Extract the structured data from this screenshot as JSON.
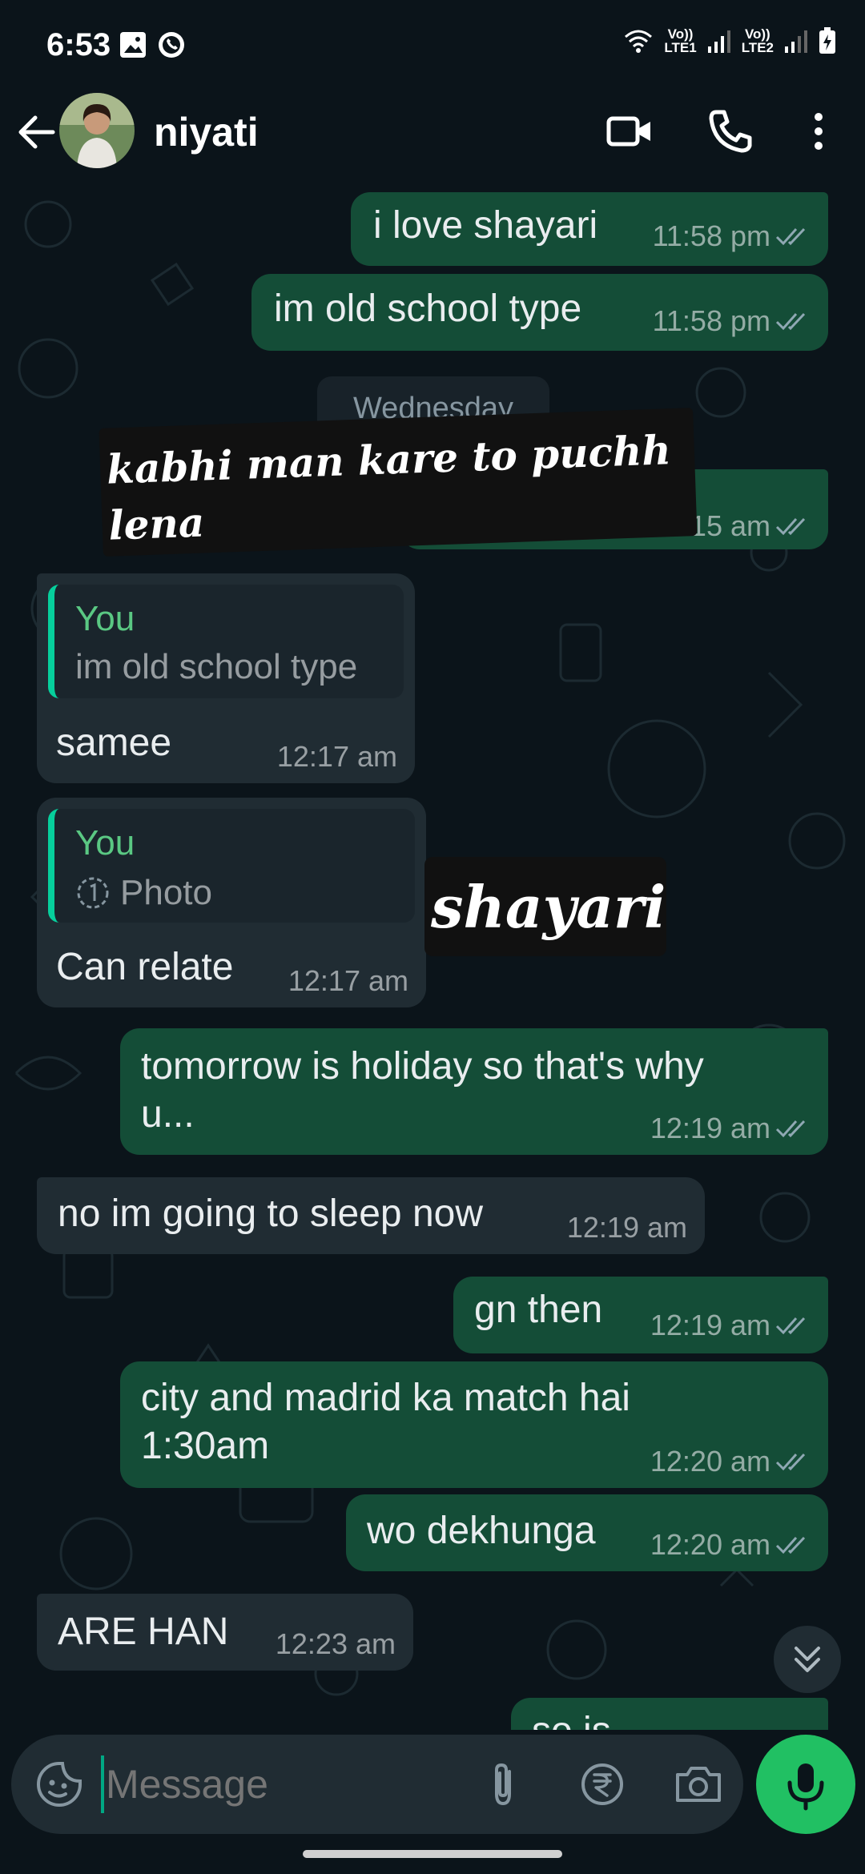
{
  "status_bar": {
    "time": "6:53",
    "sim1": [
      "Vo))",
      "LTE1"
    ],
    "sim2": [
      "Vo))",
      "LTE2"
    ]
  },
  "header": {
    "contact_name": "niyati",
    "icons": [
      "back-arrow-icon",
      "video-call-icon",
      "voice-call-icon",
      "more-options-icon"
    ]
  },
  "messages": [
    {
      "dir": "out",
      "text": "i love shayari",
      "time": "11:58 pm",
      "status": "read"
    },
    {
      "dir": "out",
      "text": "im old school type",
      "time": "11:58 pm",
      "status": "read"
    },
    {
      "dir": "out",
      "text": "",
      "time": "12:15 am",
      "status": "read"
    },
    {
      "dir": "in",
      "reply_author": "You",
      "reply_text": "im old school type",
      "text": "samee",
      "time": "12:17 am"
    },
    {
      "dir": "in",
      "reply_author": "You",
      "reply_text": "Photo",
      "text": "Can relate",
      "time": "12:17 am"
    },
    {
      "dir": "out",
      "text_line1": "tomorrow is holiday so that's why",
      "text_line2": "u...",
      "time": "12:19 am",
      "status": "read"
    },
    {
      "dir": "in",
      "text": "no im going to sleep now",
      "time": "12:19 am"
    },
    {
      "dir": "out",
      "text": "gn then",
      "time": "12:19 am",
      "status": "read"
    },
    {
      "dir": "out",
      "text_line1": "city and madrid ka match hai",
      "text_line2": "1:30am",
      "time": "12:20 am",
      "status": "read"
    },
    {
      "dir": "out",
      "text": "wo dekhunga",
      "time": "12:20 am",
      "status": "read"
    },
    {
      "dir": "in",
      "text": "ARE HAN",
      "time": "12:23 am"
    },
    {
      "dir": "out",
      "text": "so is",
      "time": "",
      "status": "partial"
    }
  ],
  "date_divider": "Wednesday",
  "stickers": [
    {
      "text_line1": "kabhi man kare to puchh",
      "text_line2": "lena"
    },
    {
      "text": "shayari"
    }
  ],
  "composer": {
    "placeholder": "Message",
    "icons": [
      "emoji-sticker-icon",
      "attach-icon",
      "payment-rupee-icon",
      "camera-icon",
      "mic-icon"
    ]
  },
  "colors": {
    "background": "#0b141a",
    "outgoing_bubble": "#144d37",
    "incoming_bubble": "#202c33",
    "accent": "#21c063",
    "reply_bar": "#06cf9c"
  }
}
